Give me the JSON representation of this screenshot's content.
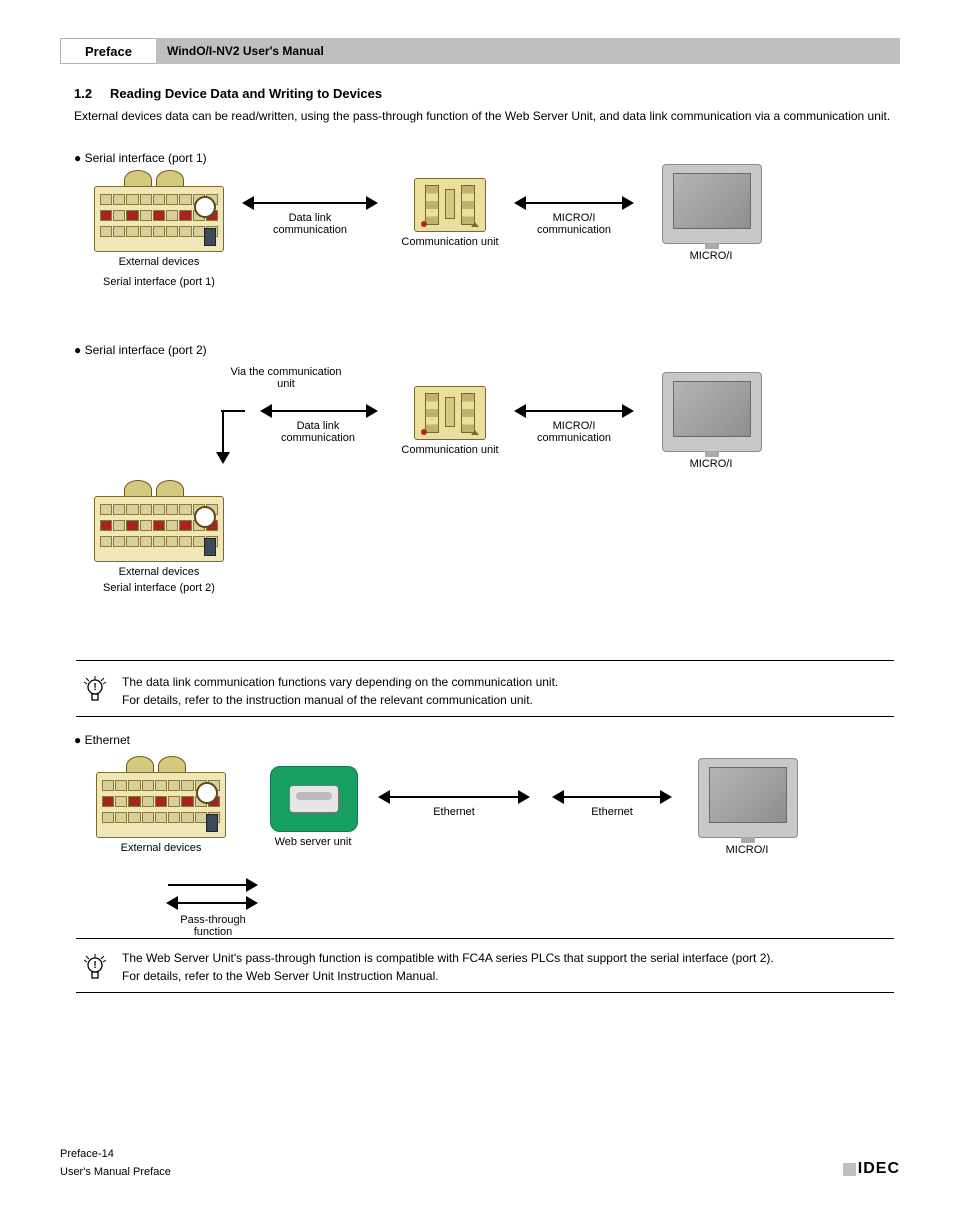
{
  "header": {
    "chapter": "Preface",
    "title": "WindO/I-NV2 User's Manual"
  },
  "section": {
    "num": "1.2",
    "name": "Reading Device Data and Writing to Devices",
    "intro": "External devices data can be read/written, using the pass-through function of the Web Server Unit, and data link communication via a communication unit.",
    "sub1_label": "Serial interface (port 1)",
    "sub2_label": "Serial interface (port 2)",
    "sub3_label": "Ethernet"
  },
  "diagram": {
    "ext_dev": "External devices",
    "data_link": "Data link\ncommunication",
    "comm_unit": "Communication unit",
    "hg_comm": "MICRO/I\ncommunication",
    "micro_i": "MICRO/I",
    "serial_if1": "Serial interface (port 1)",
    "serial_if2": "Serial interface (port 2)",
    "via_comm_unit": "Via the communication\nunit",
    "ethernet": "Ethernet",
    "pass_through": "Pass-through\nfunction",
    "web_server": "Web server unit"
  },
  "notes": {
    "n1a": "The data link communication functions vary depending on the communication unit.",
    "n1b": "For details, refer to the instruction manual of the relevant communication unit.",
    "n2a": "The Web Server Unit's pass-through function is compatible with FC4A series PLCs that support the serial interface (port 2).",
    "n2b": "For details, refer to the Web Server Unit Instruction Manual."
  },
  "footer": {
    "page": "Preface-14",
    "doc": "User's Manual Preface",
    "brand": "IDEC"
  }
}
